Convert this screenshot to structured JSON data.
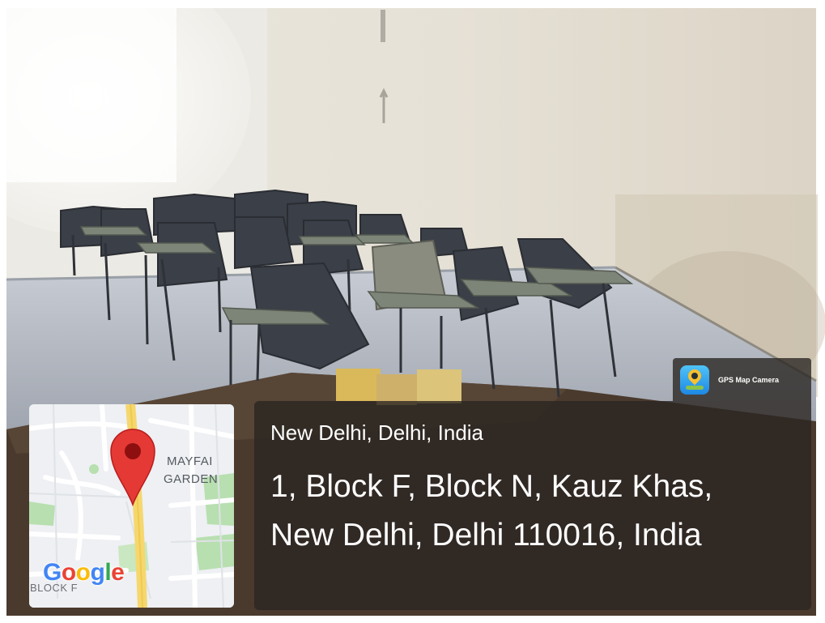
{
  "badge": {
    "app_name": "GPS Map Camera",
    "icon": "gps-map-camera-app-icon"
  },
  "location": {
    "title": "New Delhi, Delhi, India",
    "address_line1": "1, Block F, Block N, Kauz Khas,",
    "address_line2": "New Delhi, Delhi 110016, India"
  },
  "map": {
    "labels": [
      "MAYFAI",
      "GARDEN",
      "BLOCK F"
    ],
    "logo_text": "Google",
    "pin_icon": "map-pin-icon",
    "colors": {
      "pin": "#e53935",
      "road_yellow": "#f5d76e",
      "park_green": "#b8dfb0",
      "land": "#eef0f3"
    }
  },
  "photo": {
    "description_icon": "classroom-photo"
  }
}
